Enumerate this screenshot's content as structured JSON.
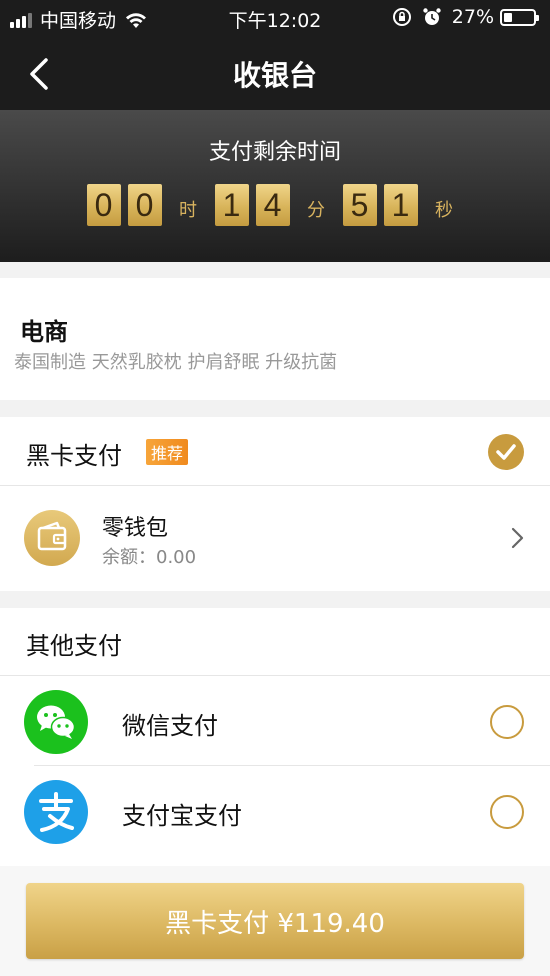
{
  "status_bar": {
    "carrier": "中国移动",
    "time": "下午12:02",
    "battery": "27%",
    "battery_level": 0.27
  },
  "nav": {
    "title": "收银台",
    "back_icon": "chevron-left-icon"
  },
  "countdown": {
    "label": "支付剩余时间",
    "hours": [
      "0",
      "0"
    ],
    "hours_unit": "时",
    "minutes": [
      "1",
      "4"
    ],
    "minutes_unit": "分",
    "seconds": [
      "5",
      "1"
    ],
    "seconds_unit": "秒"
  },
  "product": {
    "title": "电商",
    "description": "泰国制造 天然乳胶枕 护肩舒眠 升级抗菌"
  },
  "black_card": {
    "label": "黑卡支付",
    "badge": "推荐",
    "selected": true,
    "wallet": {
      "name": "零钱包",
      "balance": "余额：0.00"
    }
  },
  "other_payment": {
    "title": "其他支付",
    "methods": [
      {
        "name": "微信支付",
        "icon": "wechat-icon",
        "selected": false
      },
      {
        "name": "支付宝支付",
        "icon": "alipay-icon",
        "selected": false
      }
    ]
  },
  "pay_button": {
    "label": "黑卡支付 ¥119.40"
  },
  "colors": {
    "gold": "#c89b3e",
    "dark_header": "#1c1c1c",
    "wechat_green": "#1bc11d",
    "alipay_blue": "#1ea0e8",
    "badge_orange": "#f08a1e"
  }
}
